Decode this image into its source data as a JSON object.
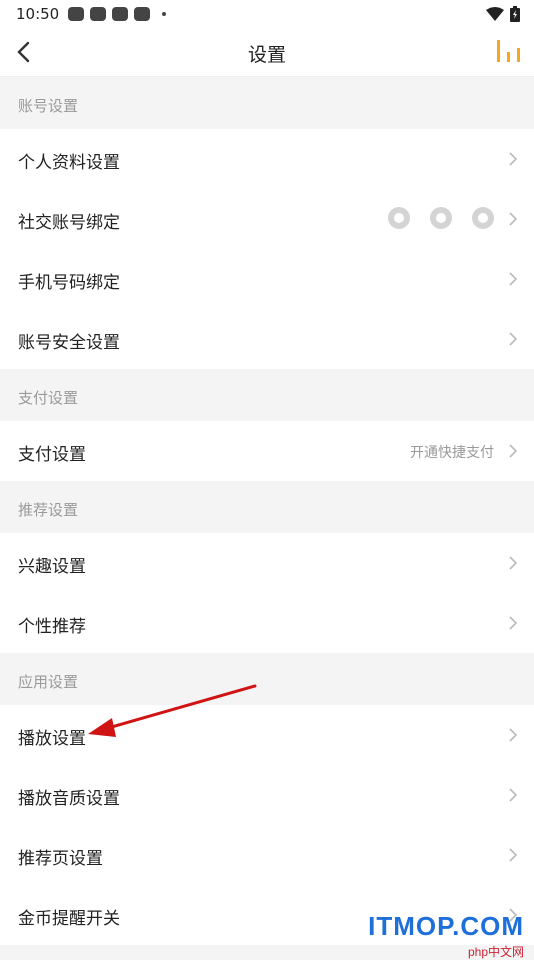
{
  "status_bar": {
    "time": "10:50"
  },
  "header": {
    "title": "设置"
  },
  "sections": {
    "account": {
      "title": "账号设置",
      "items": [
        {
          "label": "个人资料设置"
        },
        {
          "label": "社交账号绑定",
          "social": [
            "wechat-icon",
            "qq-icon",
            "weibo-icon"
          ]
        },
        {
          "label": "手机号码绑定"
        },
        {
          "label": "账号安全设置"
        }
      ]
    },
    "payment": {
      "title": "支付设置",
      "items": [
        {
          "label": "支付设置",
          "extra": "开通快捷支付"
        }
      ]
    },
    "recommend": {
      "title": "推荐设置",
      "items": [
        {
          "label": "兴趣设置"
        },
        {
          "label": "个性推荐"
        }
      ]
    },
    "app": {
      "title": "应用设置",
      "items": [
        {
          "label": "播放设置"
        },
        {
          "label": "播放音质设置"
        },
        {
          "label": "推荐页设置"
        },
        {
          "label": "金币提醒开关"
        }
      ]
    }
  },
  "watermark": {
    "text": "ITMOP.COM",
    "sub": "php中文网"
  },
  "colors": {
    "accent": "#f5a623",
    "arrow": "#d01414",
    "watermark": "#1e6fd9"
  }
}
